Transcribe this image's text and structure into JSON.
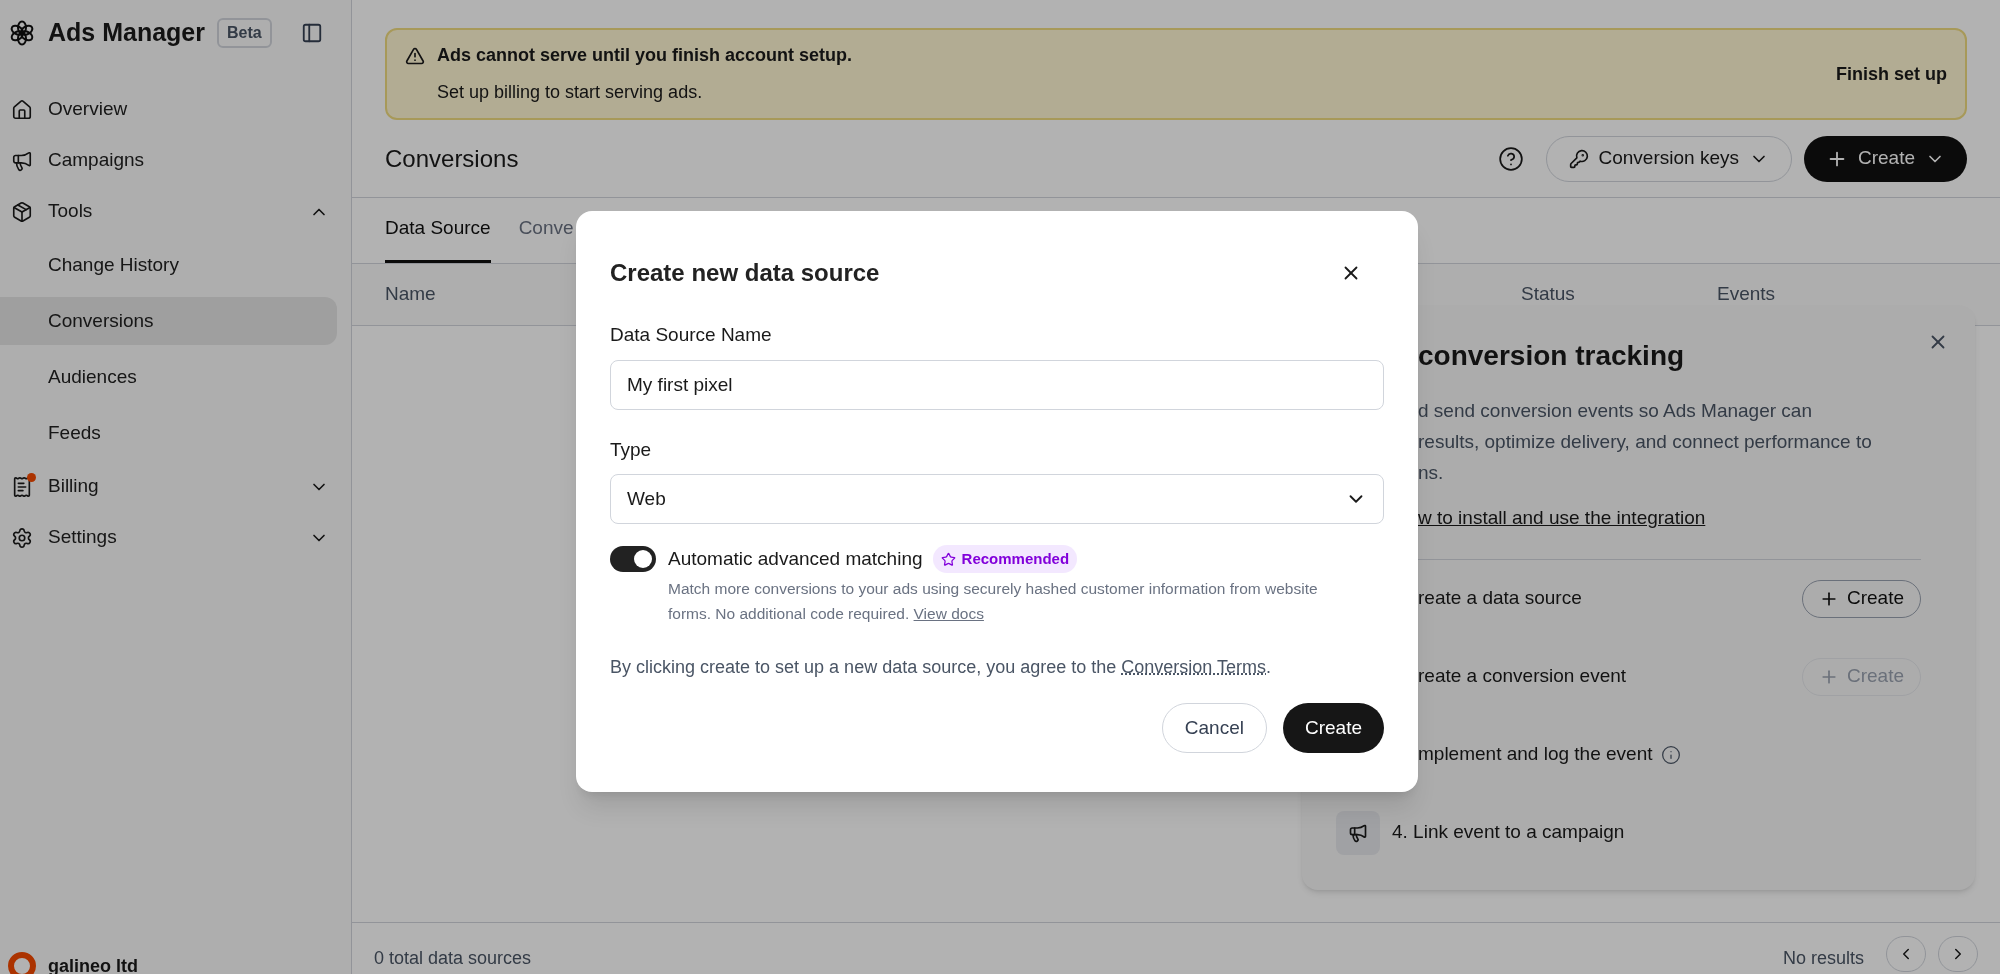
{
  "sidebar": {
    "brand": {
      "title": "Ads Manager",
      "badge": "Beta"
    },
    "items": [
      {
        "label": "Overview",
        "selected": false
      },
      {
        "label": "Campaigns",
        "selected": false
      },
      {
        "label": "Tools",
        "selected": false,
        "expanded": true,
        "children": [
          {
            "label": "Change History",
            "selected": false
          },
          {
            "label": "Conversions",
            "selected": true
          },
          {
            "label": "Audiences",
            "selected": false
          },
          {
            "label": "Feeds",
            "selected": false
          }
        ]
      },
      {
        "label": "Billing",
        "selected": false,
        "expanded": false,
        "notification": true
      },
      {
        "label": "Settings",
        "selected": false,
        "expanded": false
      }
    ],
    "account": {
      "name": "galineo ltd"
    }
  },
  "banner": {
    "title": "Ads cannot serve until you finish account setup.",
    "message": "Set up billing to start serving ads.",
    "action": "Finish set up"
  },
  "page": {
    "title": "Conversions",
    "buttons": [
      {
        "label": "Conversion keys"
      },
      {
        "label": "Create"
      }
    ]
  },
  "tabs": [
    {
      "label": "Data Source",
      "selected": true
    },
    {
      "label": "Conve",
      "selected": false
    }
  ],
  "table": {
    "columns": [
      "Name",
      "Status",
      "Events"
    ]
  },
  "footer": {
    "count": "0 total data sources",
    "results": "No results"
  },
  "panel": {
    "title": "conversion tracking",
    "description": [
      "d send conversion events so Ads Manager can",
      "results, optimize delivery, and connect performance to",
      "ns."
    ],
    "link": "w to install and use the integration",
    "steps": [
      {
        "label": "reate a data source",
        "action": {
          "label": "Create",
          "disabled": false
        }
      },
      {
        "label": "reate a conversion event",
        "action": {
          "label": "Create",
          "disabled": true
        }
      },
      {
        "label": "mplement and log the event",
        "info": true
      },
      {
        "label": "4. Link event to a campaign",
        "icon": true
      }
    ]
  },
  "modal": {
    "title": "Create new data source",
    "name_field": {
      "label": "Data Source Name",
      "value": "My first pixel"
    },
    "type_field": {
      "label": "Type",
      "value": "Web"
    },
    "matching": {
      "label": "Automatic advanced matching",
      "on": true,
      "badge": "Recommended",
      "description": "Match more conversions to your ads using securely hashed customer information from website forms. No additional code required.",
      "link": "View docs"
    },
    "terms": {
      "before": "By clicking create to set up a new data source, you agree to the",
      "link": "Conversion Terms",
      "after": "."
    },
    "buttons": [
      {
        "label": "Cancel",
        "primary": false
      },
      {
        "label": "Create",
        "primary": true
      }
    ]
  }
}
